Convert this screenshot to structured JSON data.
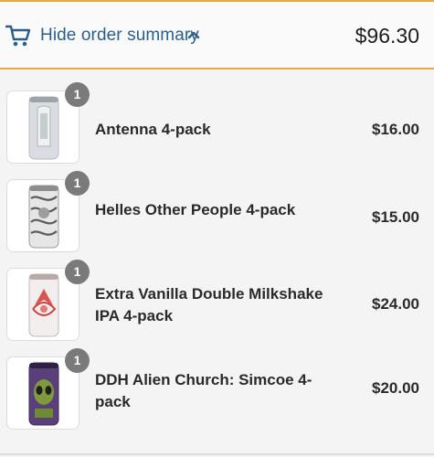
{
  "summary": {
    "toggle_label": "Hide order summary",
    "total": "$96.30",
    "cart_icon": "cart-icon",
    "chevron_icon": "chevron-up-icon"
  },
  "colors": {
    "link": "#2b5f8a",
    "accent_border": "#e2a94a",
    "badge": "#7a7a7a"
  },
  "items": [
    {
      "quantity": "1",
      "name": "Antenna 4-pack",
      "price": "$16.00"
    },
    {
      "quantity": "1",
      "name": "Helles Other People 4-pack",
      "price": "$15.00"
    },
    {
      "quantity": "1",
      "name": "Extra Vanilla Double Milkshake IPA 4-pack",
      "price": "$24.00"
    },
    {
      "quantity": "1",
      "name": "DDH Alien Church: Simcoe 4-pack",
      "price": "$20.00"
    }
  ]
}
